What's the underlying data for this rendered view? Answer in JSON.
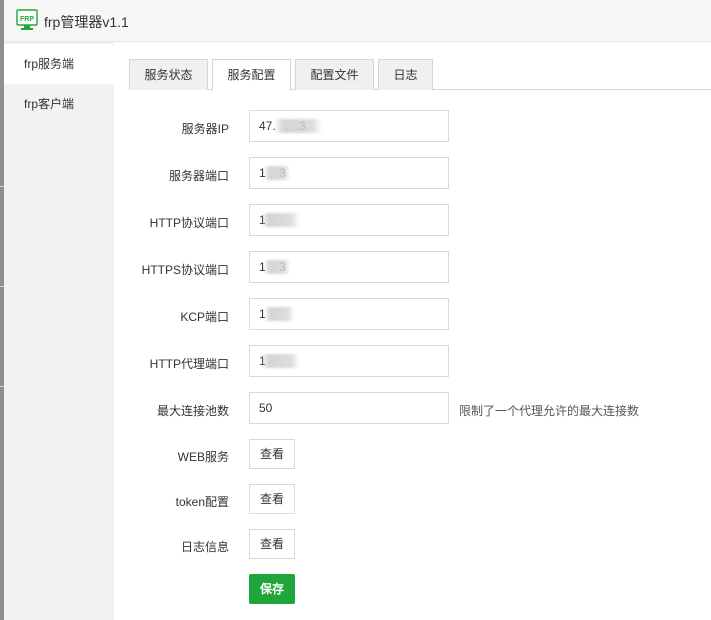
{
  "app": {
    "icon_text": "FRP",
    "title": "frp管理器v1.1"
  },
  "sidebar": {
    "items": [
      {
        "label": "frp服务端",
        "active": true
      },
      {
        "label": "frp客户端",
        "active": false
      }
    ]
  },
  "tabs": [
    {
      "label": "服务状态",
      "active": false
    },
    {
      "label": "服务配置",
      "active": true
    },
    {
      "label": "配置文件",
      "active": false
    },
    {
      "label": "日志",
      "active": false
    }
  ],
  "form": {
    "server_ip": {
      "label": "服务器IP",
      "value": "47.   .  .3"
    },
    "server_port": {
      "label": "服务器端口",
      "value": "1    3"
    },
    "http_port": {
      "label": "HTTP协议端口",
      "value": "1    "
    },
    "https_port": {
      "label": "HTTPS协议端口",
      "value": "1    3"
    },
    "kcp_port": {
      "label": "KCP端口",
      "value": "1    "
    },
    "http_proxy_port": {
      "label": "HTTP代理端口",
      "value": "1    "
    },
    "max_pool": {
      "label": "最大连接池数",
      "value": "50",
      "hint": "限制了一个代理允许的最大连接数"
    },
    "web_service": {
      "label": "WEB服务",
      "button": "查看"
    },
    "token_config": {
      "label": "token配置",
      "button": "查看"
    },
    "log_info": {
      "label": "日志信息",
      "button": "查看"
    },
    "save_label": "保存"
  },
  "colors": {
    "accent": "#20a53a",
    "sidebar_bg": "#f2f2f2",
    "tab_bg": "#f0f0f0"
  }
}
